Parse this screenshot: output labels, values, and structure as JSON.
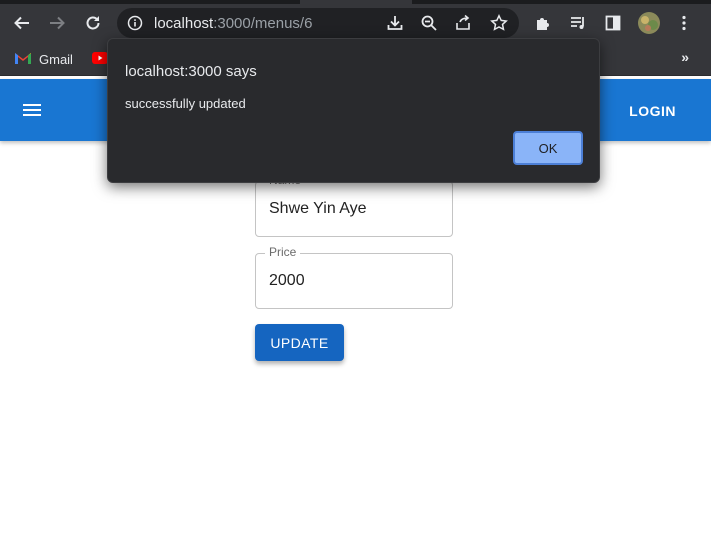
{
  "browser": {
    "url_host": "localhost",
    "url_rest": ":3000/menus/6",
    "icons": [
      "back-icon",
      "forward-icon",
      "reload-icon",
      "info-icon",
      "download-icon",
      "zoom-out-icon",
      "share-icon",
      "star-icon",
      "extensions-icon",
      "reading-list-icon",
      "side-panel-icon",
      "profile-avatar",
      "kebab-menu-icon"
    ],
    "bookmarks": [
      {
        "label": "Gmail",
        "icon": "gmail-icon"
      },
      {
        "label": "",
        "icon": "youtube-icon"
      }
    ],
    "more_bookmarks": "»"
  },
  "appbar": {
    "menu_icon": "hamburger-icon",
    "login_label": "LOGIN"
  },
  "form": {
    "name_label": "Name",
    "name_value": "Shwe Yin Aye",
    "price_label": "Price",
    "price_value": "2000",
    "update_label": "UPDATE"
  },
  "alert": {
    "title": "localhost:3000 says",
    "message": "successfully updated",
    "ok_label": "OK"
  },
  "colors": {
    "appbar": "#1976d2",
    "button": "#1565c0",
    "dialog_bg": "#292a2d",
    "ok_button": "#8ab4f8"
  }
}
